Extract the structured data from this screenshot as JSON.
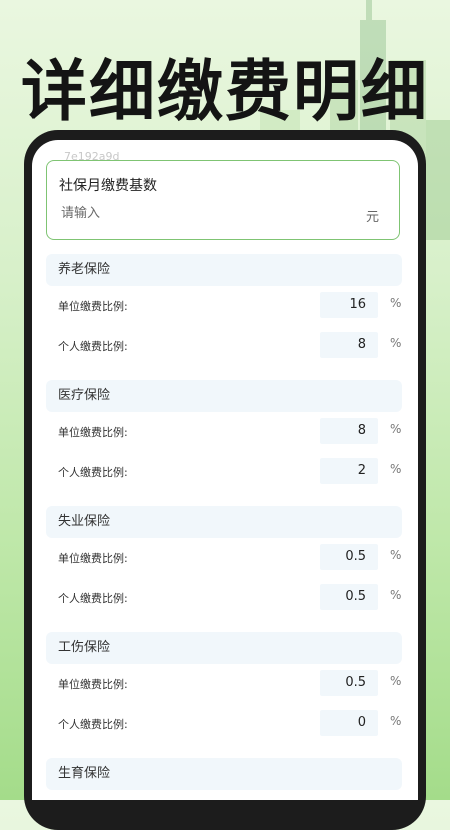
{
  "headline": "详细缴费明细",
  "hash_text": "7e192a9d",
  "base": {
    "title": "社保月缴费基数",
    "placeholder": "请输入",
    "unit": "元"
  },
  "sections": [
    {
      "title": "养老保险",
      "rows": [
        {
          "label": "单位缴费比例:",
          "value": "16",
          "unit": "%"
        },
        {
          "label": "个人缴费比例:",
          "value": "8",
          "unit": "%"
        }
      ]
    },
    {
      "title": "医疗保险",
      "rows": [
        {
          "label": "单位缴费比例:",
          "value": "8",
          "unit": "%"
        },
        {
          "label": "个人缴费比例:",
          "value": "2",
          "unit": "%"
        }
      ]
    },
    {
      "title": "失业保险",
      "rows": [
        {
          "label": "单位缴费比例:",
          "value": "0.5",
          "unit": "%"
        },
        {
          "label": "个人缴费比例:",
          "value": "0.5",
          "unit": "%"
        }
      ]
    },
    {
      "title": "工伤保险",
      "rows": [
        {
          "label": "单位缴费比例:",
          "value": "0.5",
          "unit": "%"
        },
        {
          "label": "个人缴费比例:",
          "value": "0",
          "unit": "%"
        }
      ]
    },
    {
      "title": "生育保险",
      "rows": []
    }
  ]
}
